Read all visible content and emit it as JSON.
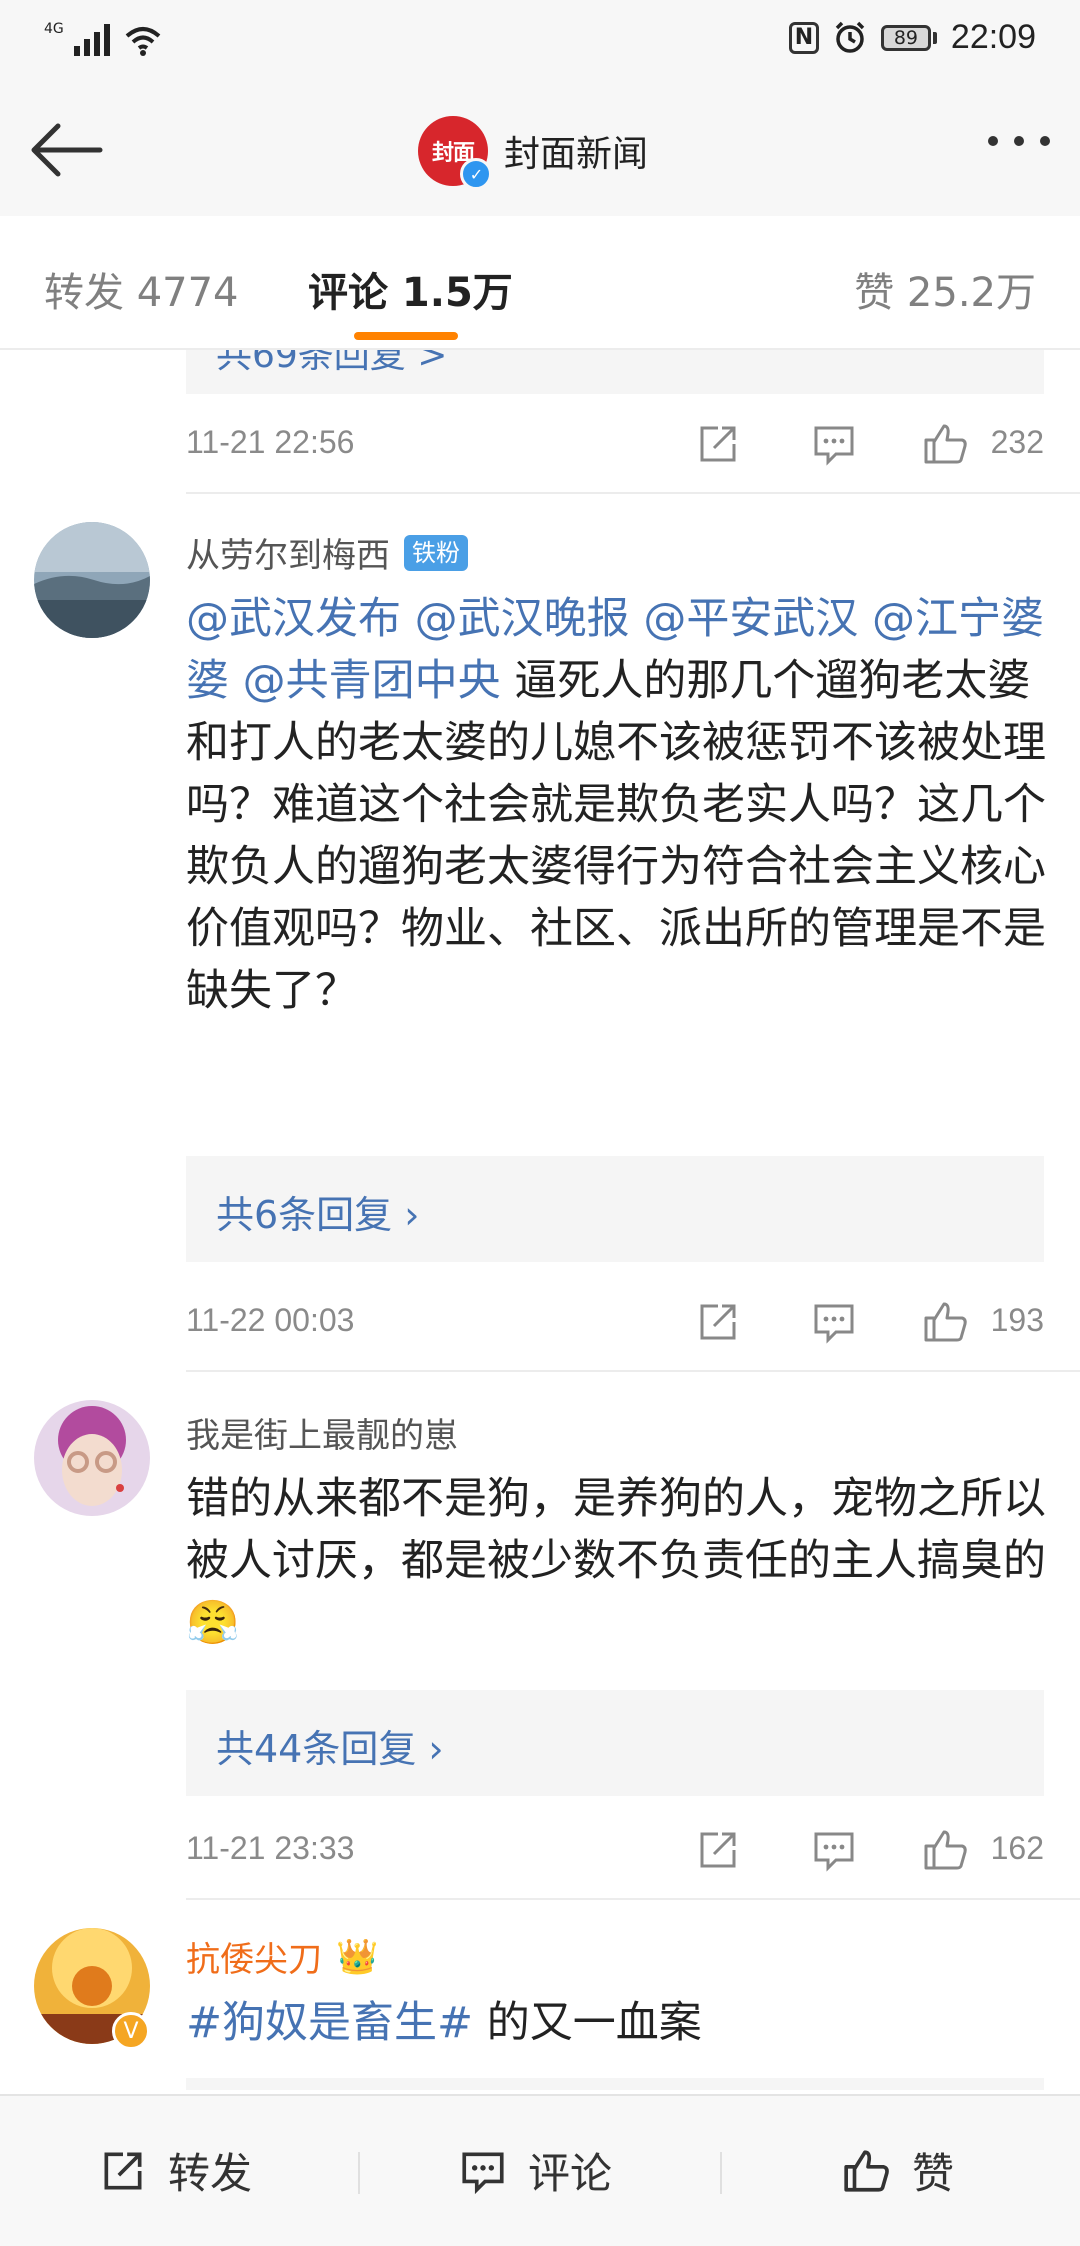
{
  "status_bar": {
    "network": "4G",
    "battery": "89",
    "time": "22:09"
  },
  "nav": {
    "title": "封面新闻",
    "logo_text": "封面"
  },
  "tabs": {
    "repost": "转发 4774",
    "comments": "评论 1.5万",
    "likes": "赞 25.2万"
  },
  "top_partial": {
    "reply_text": "共69条回复 >",
    "time": "11-21 22:56",
    "like_count": "232"
  },
  "comments": [
    {
      "username": "从劳尔到梅西",
      "badge": "铁粉",
      "mentions": "@武汉发布 @武汉晚报 @平安武汉 @江宁婆婆 @共青团中央",
      "text": " 逼死人的那几个遛狗老太婆和打人的老太婆的儿媳不该被惩罚不该被处理吗？难道这个社会就是欺负老实人吗？这几个欺负人的遛狗老太婆得行为符合社会主义核心价值观吗？物业、社区、派出所的管理是不是缺失了？",
      "replies": "共6条回复 ›",
      "time": "11-22 00:03",
      "like_count": "193"
    },
    {
      "username": "我是街上最靓的崽",
      "text": "错的从来都不是狗，是养狗的人，宠物之所以被人讨厌，都是被少数不负责任的主人搞臭的😤",
      "replies": "共44条回复 ›",
      "time": "11-21 23:33",
      "like_count": "162"
    },
    {
      "username": "抗倭尖刀",
      "hashtag": "#狗奴是畜生#",
      "text": " 的又一血案"
    }
  ],
  "bottom_bar": {
    "repost": "转发",
    "comment": "评论",
    "like": "赞"
  },
  "colors": {
    "accent": "#ff8200",
    "link": "#4673b3",
    "brand": "#d7262c"
  }
}
